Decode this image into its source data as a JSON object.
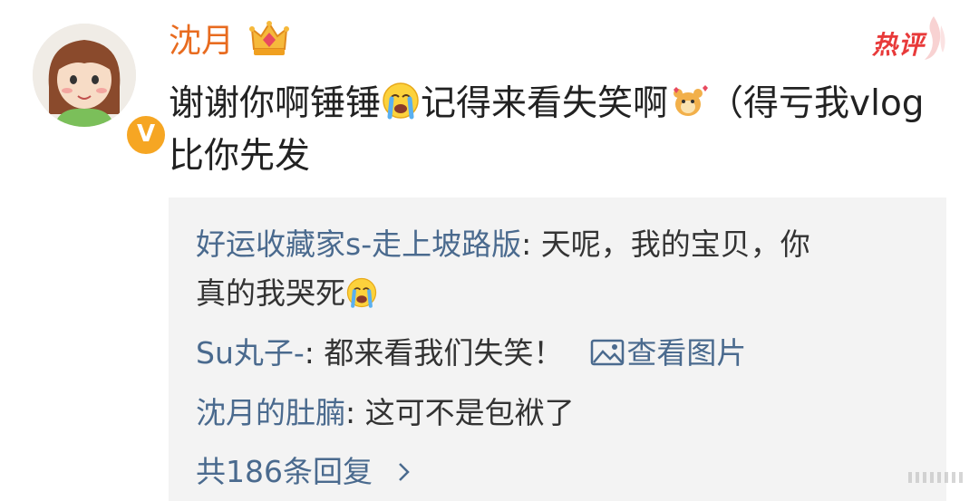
{
  "post": {
    "author": "沈月",
    "hot_label": "热评",
    "comment_parts": [
      "谢谢你啊锤锤",
      "记得来看失笑啊",
      "（得亏我vlog比你先发"
    ],
    "emoji_icons": [
      "crying-face-icon",
      "hamster-icon"
    ],
    "verified_badge": "V"
  },
  "replies": [
    {
      "name": "好运收藏家s-走上坡路版",
      "text": ": 天呢，我的宝贝，你真的我哭死",
      "emoji": "crying-face-icon"
    },
    {
      "name": "Su丸子-",
      "text": ": 都来看我们失笑！",
      "image_link": "查看图片"
    },
    {
      "name": "沈月的肚腩",
      "text": ": 这可不是包袱了"
    }
  ],
  "more_replies": "共186条回复",
  "colors": {
    "username": "#e86b1f",
    "link": "#4a6a8e",
    "hot": "#e83a3a",
    "reply_bg": "#f3f3f3"
  }
}
